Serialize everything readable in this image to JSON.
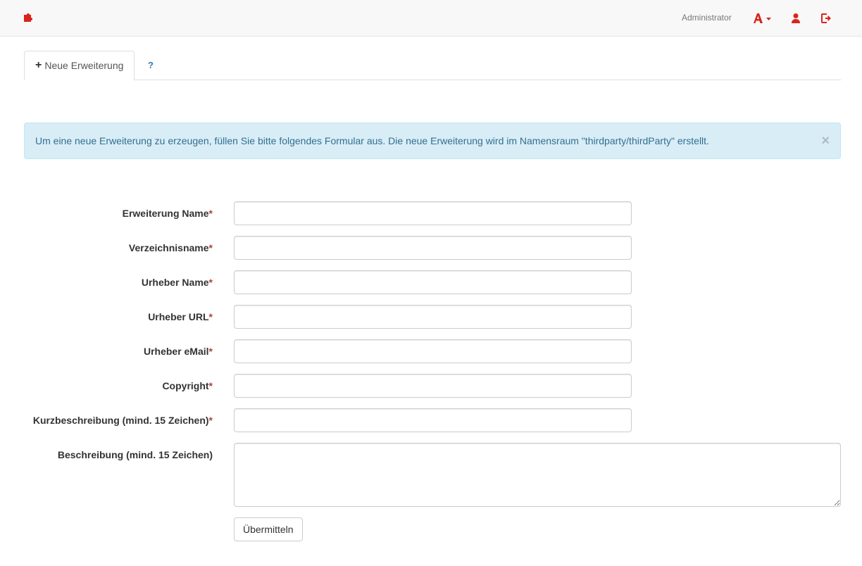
{
  "colors": {
    "brand": "#d9251c",
    "link": "#337ab7",
    "alert_bg": "#d9edf7",
    "alert_text": "#31708f",
    "required": "#a94442"
  },
  "navbar": {
    "brand_icon": "puzzle-icon",
    "user_label": "Administrator",
    "icons": [
      "language-dropdown-icon",
      "user-profile-icon",
      "logout-icon"
    ]
  },
  "tabs": {
    "new_extension_icon": "+",
    "new_extension_label": "Neue Erweiterung",
    "help_label": "?"
  },
  "alert": {
    "message": "Um eine neue Erweiterung zu erzeugen, füllen Sie bitte folgendes Formular aus. Die neue Erweiterung wird im Namensraum \"thirdparty/thirdParty\" erstellt.",
    "close_label": "×"
  },
  "form": {
    "required_marker": "*",
    "fields": [
      {
        "label": "Erweiterung Name",
        "value": "",
        "required": true
      },
      {
        "label": "Verzeichnisname",
        "value": "",
        "required": true
      },
      {
        "label": "Urheber Name",
        "value": "",
        "required": true
      },
      {
        "label": "Urheber URL",
        "value": "",
        "required": true
      },
      {
        "label": "Urheber eMail",
        "value": "",
        "required": true
      },
      {
        "label": "Copyright",
        "value": "",
        "required": true
      },
      {
        "label": "Kurzbeschreibung (mind. 15 Zeichen)",
        "value": "",
        "required": true
      }
    ],
    "description": {
      "label": "Beschreibung (mind. 15 Zeichen)",
      "value": ""
    },
    "submit_label": "Übermitteln"
  }
}
